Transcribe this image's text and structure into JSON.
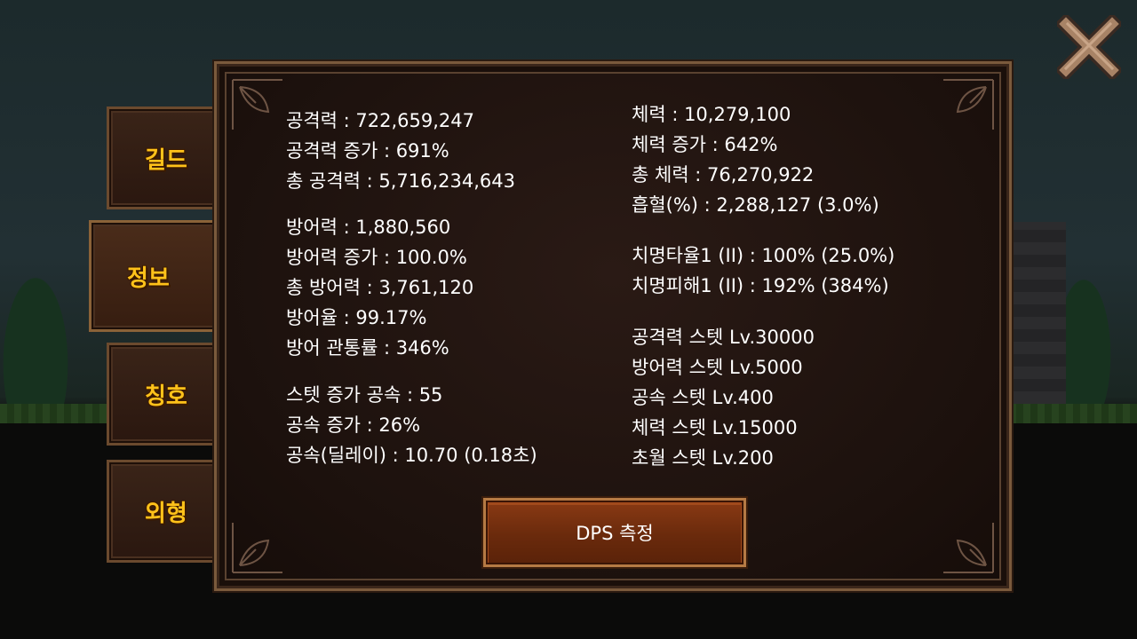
{
  "tabs": {
    "guild": "길드",
    "info": "정보",
    "title": "칭호",
    "appearance": "외형"
  },
  "stats_left": [
    "공격력 : 722,659,247",
    "공격력 증가 : 691%",
    "총 공격력 : 5,716,234,643",
    "방어력 : 1,880,560",
    "방어력 증가 : 100.0%",
    "총 방어력 : 3,761,120",
    "방어율 : 99.17%",
    "방어 관통률 : 346%",
    "스텟 증가 공속 : 55",
    "공속 증가 : 26%",
    "공속(딜레이) : 10.70 (0.18초)"
  ],
  "stats_right": [
    "체력 : 10,279,100",
    "체력 증가 : 642%",
    "총 체력 : 76,270,922",
    "흡혈(%) : 2,288,127 (3.0%)",
    "치명타율1 (II) : 100% (25.0%)",
    "치명피해1 (II) : 192% (384%)",
    "공격력 스텟 Lv.30000",
    "방어력 스텟 Lv.5000",
    "공속 스텟 Lv.400",
    "체력 스텟 Lv.15000",
    "초월 스텟 Lv.200"
  ],
  "dps_button_label": "DPS 측정",
  "icons": {
    "close": "close-x-icon"
  },
  "colors": {
    "tab_text": "#ffc21a",
    "panel_border": "#7a5a3c",
    "button_fill": "#6a2a0c"
  }
}
